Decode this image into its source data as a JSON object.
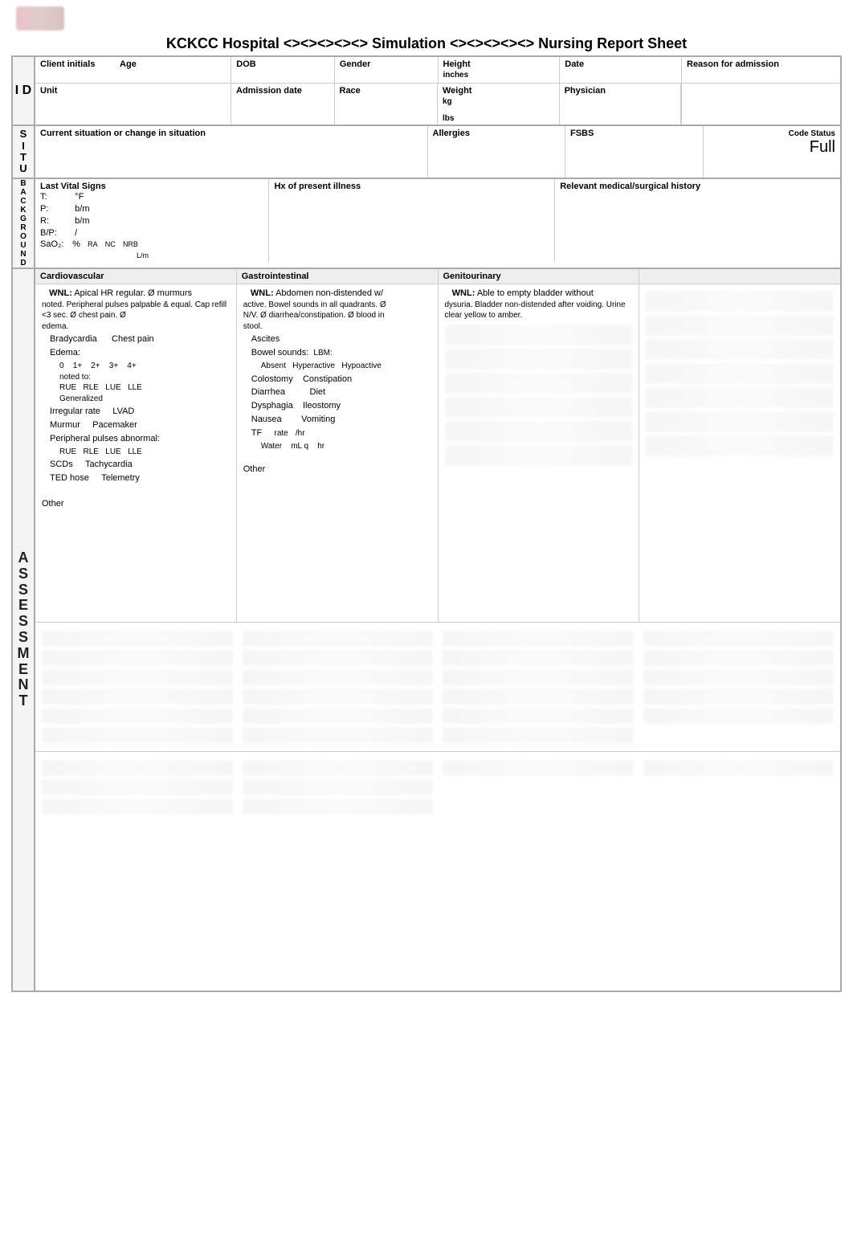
{
  "header": {
    "title": "KCKCC Hospital <><><><><> Simulation <><><><><> Nursing Report Sheet"
  },
  "sections": {
    "id": "I D",
    "situ": "S I T U",
    "background": "B A C K G R O U N D",
    "assessment": "A S S E S S M E N T"
  },
  "id_band": {
    "client_initials": "Client initials",
    "age": "Age",
    "dob": "DOB",
    "gender": "Gender",
    "height": "Height",
    "height_unit": "inches",
    "date": "Date",
    "reason": "Reason for admission",
    "unit": "Unit",
    "admission_date": "Admission date",
    "race": "Race",
    "weight": "Weight",
    "weight_unit_kg": "kg",
    "weight_unit_lbs": "lbs",
    "physician": "Physician"
  },
  "situ": {
    "current": "Current situation or change in situation",
    "allergies": "Allergies",
    "fsbs": "FSBS",
    "code_status_h": "Code Status",
    "code_status_v": "Full"
  },
  "background": {
    "last_vs": "Last Vital Signs",
    "t": "T:",
    "t_unit": "°F",
    "p": "P:",
    "p_unit": "b/m",
    "r": "R:",
    "r_unit": "b/m",
    "bp": "B/P:",
    "bp_sep": "/",
    "sao2": "SaO₂:",
    "sao2_unit": "%",
    "ra": "RA",
    "nc": "NC",
    "nrb": "NRB",
    "lm": "L/m",
    "hx": "Hx of present illness",
    "relevant": "Relevant medical/surgical history"
  },
  "assess_headers": {
    "cv": "Cardiovascular",
    "gi": "Gastrointestinal",
    "gu": "Genitourinary",
    "col4": ""
  },
  "cv": {
    "wnl": "WNL: Apical HR regular. Ø murmurs",
    "wnl2": "noted. Peripheral pulses palpable & equal. Cap refill <3 sec. Ø chest pain. Ø",
    "wnl3": "edema.",
    "brady": "Bradycardia",
    "chest_pain": "Chest pain",
    "edema": "Edema:",
    "e0": "0",
    "e1": "1+",
    "e2": "2+",
    "e3": "3+",
    "e4": "4+",
    "noted_to": "noted to:",
    "rue": "RUE",
    "rle": "RLE",
    "lue": "LUE",
    "lle": "LLE",
    "generalized": "Generalized",
    "irregular": "Irregular rate",
    "lvad": "LVAD",
    "murmur": "Murmur",
    "pacemaker": "Pacemaker",
    "pp_abnormal": "Peripheral pulses abnormal:",
    "scds": "SCDs",
    "tachy": "Tachycardia",
    "ted": "TED hose",
    "telemetry": "Telemetry",
    "other": "Other"
  },
  "gi": {
    "wnl": "WNL: Abdomen non-distended w/",
    "wnl2": "active. Bowel sounds in all quadrants. Ø",
    "wnl3": "N/V. Ø diarrhea/constipation. Ø blood in",
    "wnl4": "stool.",
    "ascites": "Ascites",
    "bowel_sounds": "Bowel sounds:",
    "lbm": "LBM:",
    "absent": "Absent",
    "hyper": "Hyperactive",
    "hypo": "Hypoactive",
    "colostomy": "Colostomy",
    "constipation": "Constipation",
    "diarrhea": "Diarrhea",
    "diet": "Diet",
    "dysphagia": "Dysphagia",
    "ileostomy": "Ileostomy",
    "nausea": "Nausea",
    "vomiting": "Vomiting",
    "tf": "TF",
    "rate": "rate",
    "perhr": "/hr",
    "water": "Water",
    "mlq": "mL q",
    "hr": "hr",
    "other": "Other"
  },
  "gu": {
    "wnl": "WNL: Able to empty bladder without",
    "wnl2": "dysuria. Bladder non-distended after voiding. Urine clear yellow to amber."
  }
}
